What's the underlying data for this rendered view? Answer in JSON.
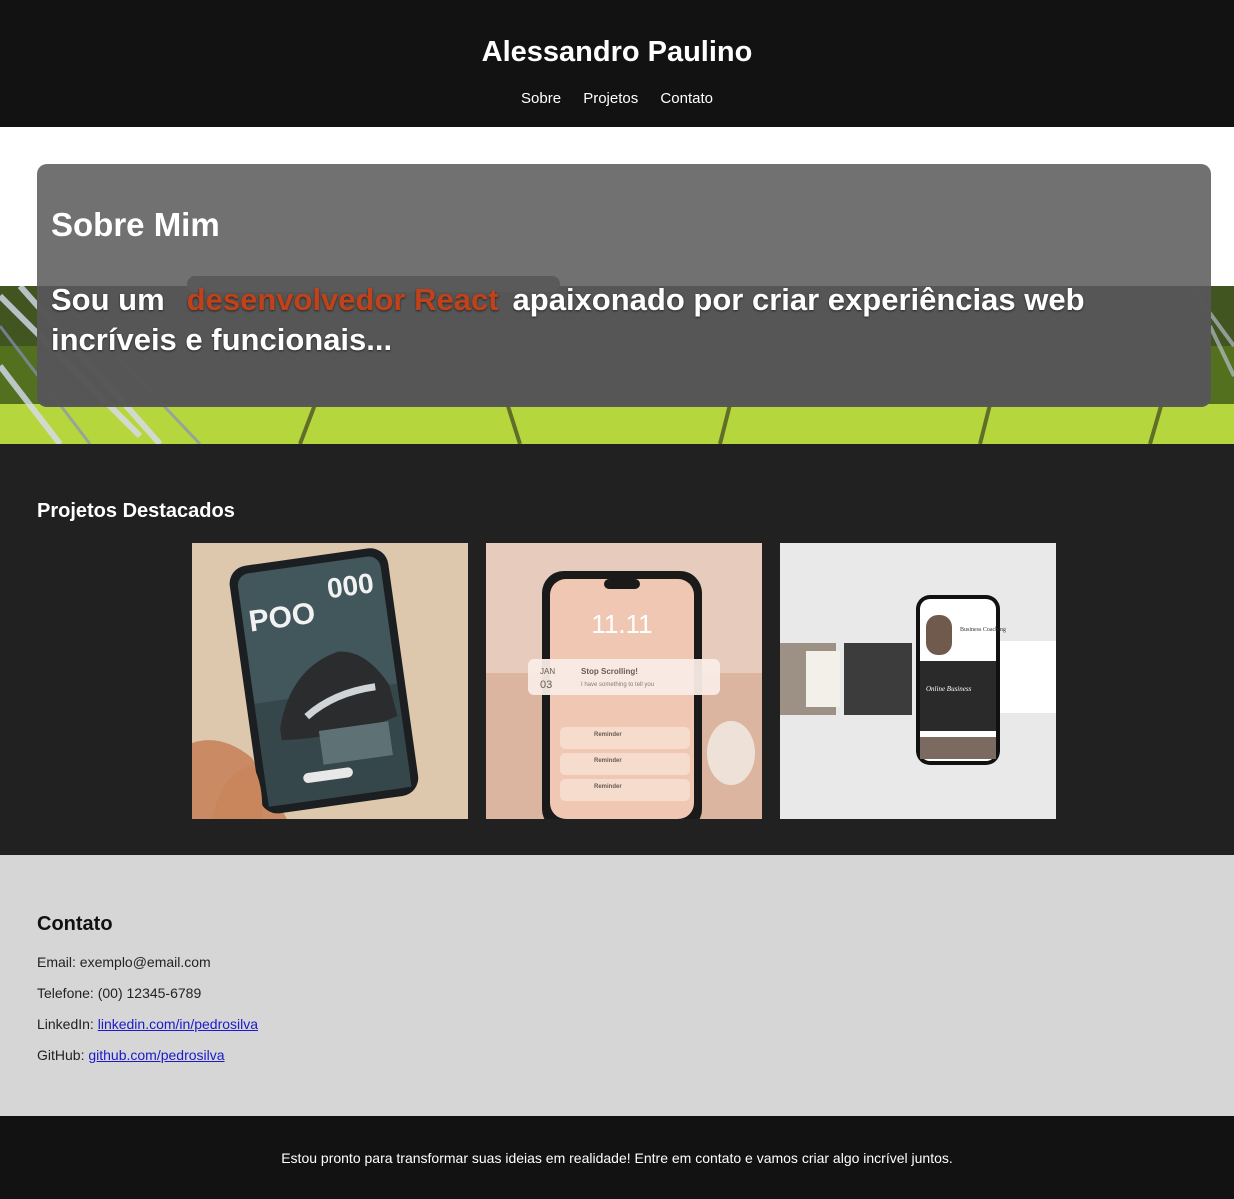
{
  "header": {
    "title": "Alessandro Paulino",
    "nav": [
      {
        "label": "Sobre"
      },
      {
        "label": "Projetos"
      },
      {
        "label": "Contato"
      }
    ]
  },
  "about": {
    "title": "Sobre Mim",
    "text_before": "Sou um",
    "highlight": "desenvolvedor React",
    "text_after": "apaixonado por criar experiências web incríveis e funcionais...",
    "highlight_color": "#c0421a"
  },
  "projects": {
    "title": "Projetos Destacados",
    "items": [
      {
        "image": "sneaker-tablet-mockup",
        "mockup_text": [
          "POO",
          "000"
        ]
      },
      {
        "image": "phone-lockscreen-mockup",
        "mockup_text": [
          "11.11",
          "JAN",
          "03",
          "Stop Scrolling!",
          "I have something to tell you",
          "Reminder",
          "Reminder",
          "Reminder"
        ]
      },
      {
        "image": "business-coaching-phone-mockup",
        "mockup_text": [
          "Business Coaching",
          "Online Business"
        ]
      }
    ]
  },
  "contact": {
    "title": "Contato",
    "email_label": "Email:",
    "email": "exemplo@email.com",
    "phone_label": "Telefone:",
    "phone": "(00) 12345-6789",
    "linkedin_label": "LinkedIn:",
    "linkedin": "linkedin.com/in/pedrosilva",
    "github_label": "GitHub:",
    "github": "github.com/pedrosilva"
  },
  "footer": {
    "text": "Estou pronto para transformar suas ideias em realidade! Entre em contato e vamos criar algo incrível juntos."
  },
  "colors": {
    "header_bg": "#121212",
    "projects_bg": "#212121",
    "contact_bg": "#d6d6d6",
    "link": "#1a1acc"
  }
}
